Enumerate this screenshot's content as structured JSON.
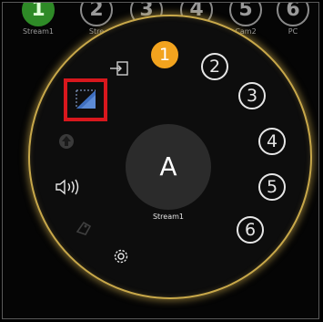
{
  "strip": {
    "items": [
      {
        "number": "1",
        "label": "Stream1",
        "active": true
      },
      {
        "number": "2",
        "label": "Stre",
        "active": false
      },
      {
        "number": "3",
        "label": "",
        "active": false
      },
      {
        "number": "4",
        "label": "",
        "active": false
      },
      {
        "number": "5",
        "label": "Cam2",
        "active": false
      },
      {
        "number": "6",
        "label": "PC",
        "active": false
      }
    ]
  },
  "wheel": {
    "center_letter": "A",
    "center_label": "Stream1",
    "numbers": [
      "1",
      "2",
      "3",
      "4",
      "5",
      "6"
    ],
    "selected_number": "1",
    "icons": [
      "exit-icon",
      "aspect-ratio-icon",
      "upload-icon",
      "volume-icon",
      "tag-icon",
      "settings-gear-icon"
    ],
    "colors": {
      "ring": "#c8a84a",
      "selected": "#f2a31e",
      "highlight": "#d8171d",
      "active_stream": "#2e8a27"
    }
  }
}
